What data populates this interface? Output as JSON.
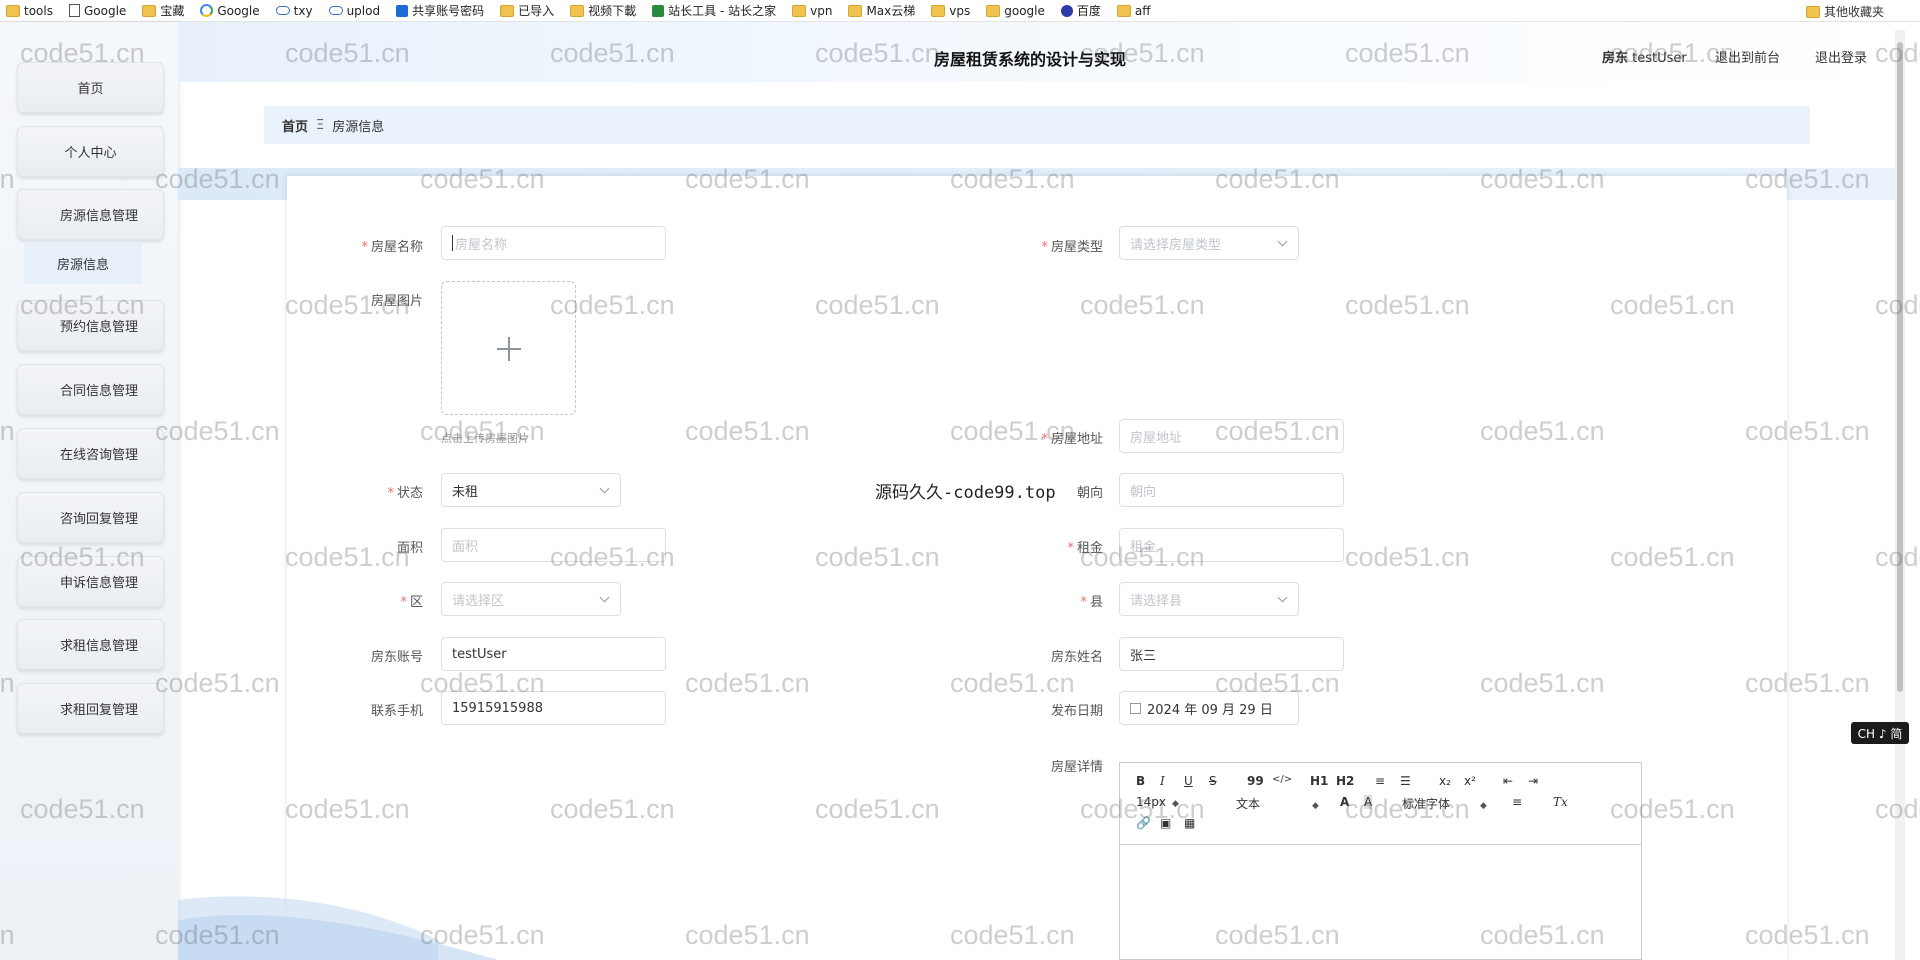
{
  "bookmarks": [
    {
      "label": "tools",
      "icon": "folder"
    },
    {
      "label": "Google",
      "icon": "doc"
    },
    {
      "label": "宝藏",
      "icon": "folder"
    },
    {
      "label": "Google",
      "icon": "google"
    },
    {
      "label": "txy",
      "icon": "cloud"
    },
    {
      "label": "uplod",
      "icon": "cloud"
    },
    {
      "label": "共享账号密码",
      "icon": "blue"
    },
    {
      "label": "已导入",
      "icon": "folder"
    },
    {
      "label": "视频下載",
      "icon": "folder"
    },
    {
      "label": "站长工具 - 站长之家",
      "icon": "tool"
    },
    {
      "label": "vpn",
      "icon": "folder"
    },
    {
      "label": "Max云梯",
      "icon": "folder"
    },
    {
      "label": "vps",
      "icon": "folder"
    },
    {
      "label": "google",
      "icon": "folder"
    },
    {
      "label": "百度",
      "icon": "paw"
    },
    {
      "label": "aff",
      "icon": "folder"
    }
  ],
  "bookmarks_right": "其他收藏夹",
  "header": {
    "title": "房屋租赁系统的设计与实现",
    "user_role": "房东",
    "user_name": "testUser",
    "back_to_front": "退出到前台",
    "logout": "退出登录"
  },
  "sidebar": {
    "items": [
      {
        "label": "首页"
      },
      {
        "label": "个人中心"
      },
      {
        "label": "房源信息管理"
      },
      {
        "label": "预约信息管理"
      },
      {
        "label": "合同信息管理"
      },
      {
        "label": "在线咨询管理"
      },
      {
        "label": "咨询回复管理"
      },
      {
        "label": "申诉信息管理"
      },
      {
        "label": "求租信息管理"
      },
      {
        "label": "求租回复管理"
      }
    ],
    "sub_item": "房源信息"
  },
  "breadcrumb": {
    "home": "首页",
    "separator": "Ξ",
    "current": "房源信息"
  },
  "form": {
    "house_name": {
      "label": "房屋名称",
      "placeholder": "房屋名称"
    },
    "house_type": {
      "label": "房屋类型",
      "placeholder": "请选择房屋类型"
    },
    "house_image": {
      "label": "房屋图片",
      "hint": "点击上传房屋图片"
    },
    "address": {
      "label": "房屋地址",
      "placeholder": "房屋地址"
    },
    "status": {
      "label": "状态",
      "value": "未租"
    },
    "orientation": {
      "label": "朝向",
      "placeholder": "朝向"
    },
    "area": {
      "label": "面积",
      "placeholder": "面积"
    },
    "rent": {
      "label": "租金",
      "placeholder": "租金"
    },
    "district": {
      "label": "区",
      "placeholder": "请选择区"
    },
    "county": {
      "label": "县",
      "placeholder": "请选择县"
    },
    "landlord_account": {
      "label": "房东账号",
      "value": "testUser"
    },
    "landlord_name": {
      "label": "房东姓名",
      "value": "张三"
    },
    "phone": {
      "label": "联系手机",
      "value": "15915915988"
    },
    "publish_date": {
      "label": "发布日期",
      "value": "2024 年 09 月 29 日"
    },
    "details": {
      "label": "房屋详情"
    }
  },
  "editor": {
    "font_size": "14px",
    "block_type": "文本",
    "font_family": "标准字体",
    "bold": "B",
    "italic": "I",
    "underline": "U",
    "strike": "S",
    "quote": "99",
    "code": "</>",
    "h1": "H1",
    "h2": "H2",
    "sub": "x₂",
    "sup": "x²",
    "color": "A",
    "background": "A",
    "clean": "Tx"
  },
  "overlay_text": "源码久久-code99.top",
  "watermark": "code51.cn",
  "ime": "CH ♪ 简"
}
